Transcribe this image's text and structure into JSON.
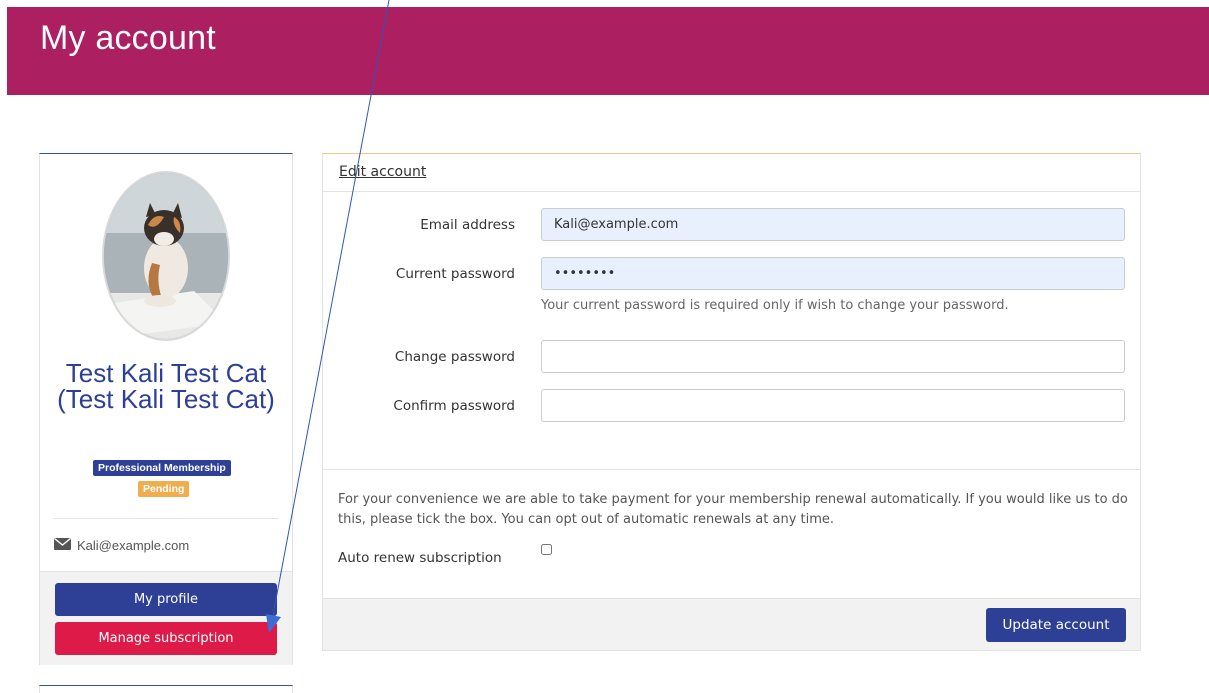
{
  "header": {
    "title": "My account"
  },
  "profile": {
    "name": "Test Kali Test Cat (Test Kali Test Cat)",
    "badges": [
      "Professional Membership",
      "Pending"
    ],
    "email": "Kali@example.com",
    "my_profile_label": "My profile",
    "manage_subscription_label": "Manage subscription"
  },
  "edit": {
    "heading": "Edit account",
    "email_label": "Email address",
    "email_value": "Kali@example.com",
    "current_password_label": "Current password",
    "current_password_value": "••••••••",
    "current_password_help": "Your current password is required only if wish to change your password.",
    "change_password_label": "Change password",
    "change_password_value": "",
    "confirm_password_label": "Confirm password",
    "confirm_password_value": "",
    "renew_text": "For your convenience we are able to take payment for your membership renewal automatically. If you would like us to do this, please tick the box. You can opt out of automatic renewals at any time.",
    "auto_renew_label": "Auto renew subscription",
    "auto_renew_checked": false,
    "update_label": "Update account"
  },
  "colors": {
    "header": "#ac1f61",
    "primary": "#2e4096",
    "danger": "#de1a49",
    "warning": "#f0ad4e"
  },
  "icons": {
    "email": "envelope-icon"
  }
}
